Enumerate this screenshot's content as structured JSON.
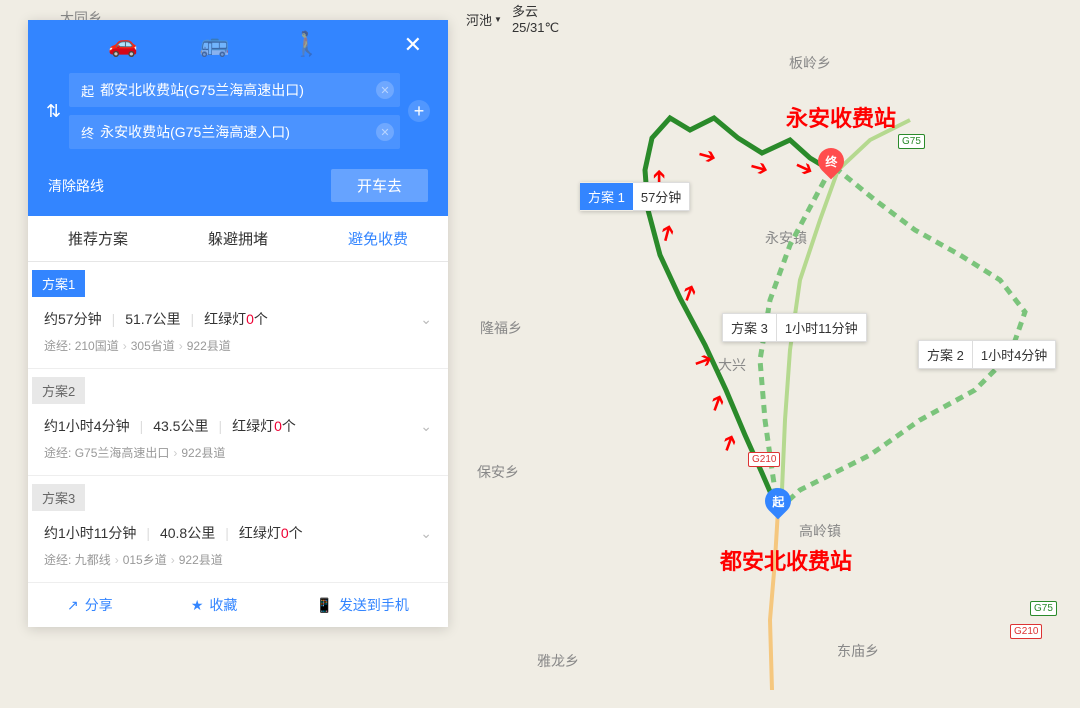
{
  "weather": {
    "loc": "河池",
    "cond": "多云",
    "temp": "25/31℃"
  },
  "panel": {
    "start_tag": "起",
    "end_tag": "终",
    "start_value": "都安北收费站(G75兰海高速出口)",
    "end_value": "永安收费站(G75兰海高速入口)",
    "clear": "清除路线",
    "go": "开车去"
  },
  "tabs": {
    "rec": "推荐方案",
    "avoid_jam": "躲避拥堵",
    "avoid_toll": "避免收费"
  },
  "plans": [
    {
      "label": "方案1",
      "time": "约57分钟",
      "dist": "51.7公里",
      "lights_pre": "红绿灯",
      "lights_n": "0",
      "lights_suf": "个",
      "via_lbl": "途经:",
      "via": [
        "210国道",
        "305省道",
        "922县道"
      ]
    },
    {
      "label": "方案2",
      "time": "约1小时4分钟",
      "dist": "43.5公里",
      "lights_pre": "红绿灯",
      "lights_n": "0",
      "lights_suf": "个",
      "via_lbl": "途经:",
      "via": [
        "G75兰海高速出口",
        "922县道"
      ]
    },
    {
      "label": "方案3",
      "time": "约1小时11分钟",
      "dist": "40.8公里",
      "lights_pre": "红绿灯",
      "lights_n": "0",
      "lights_suf": "个",
      "via_lbl": "途经:",
      "via": [
        "九都线",
        "015乡道",
        "922县道"
      ]
    }
  ],
  "footer": {
    "share": "分享",
    "fav": "收藏",
    "send": "发送到手机"
  },
  "map": {
    "callouts": {
      "p1_lbl": "方案 1",
      "p1_t": "57分钟",
      "p2_lbl": "方案 2",
      "p2_t": "1小时4分钟",
      "p3_lbl": "方案 3",
      "p3_t": "1小时11分钟"
    },
    "big_start": "都安北收费站",
    "big_end": "永安收费站",
    "marker_start": "起",
    "marker_end": "终",
    "places": {
      "datong": "大同乡",
      "banling": "板岭乡",
      "yongan": "永安镇",
      "longfu": "隆福乡",
      "baoan": "保安乡",
      "gaoling": "高岭镇",
      "dongmiao": "东庙乡",
      "yalong": "雅龙乡",
      "daxing": "大兴"
    },
    "shields": {
      "g75a": "G75",
      "g75b": "G75",
      "g210a": "G210",
      "g210b": "G210"
    }
  }
}
